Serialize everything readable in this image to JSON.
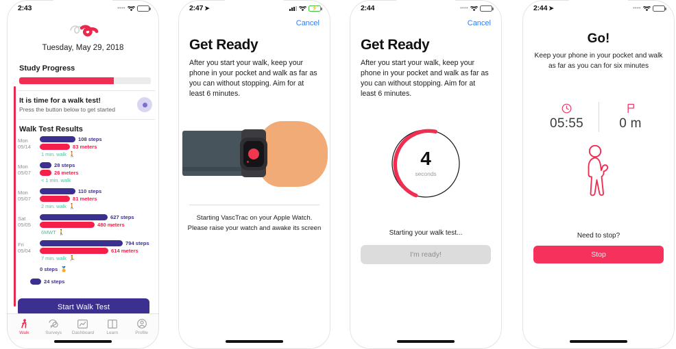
{
  "app": {
    "name": "VascTrac",
    "accent_red": "#ef2e51",
    "accent_purple": "#3b2f8f",
    "teal": "#45c3a0"
  },
  "screen1": {
    "status": {
      "time": "2:43",
      "signal": "signal-dots-icon",
      "wifi": "wifi-icon",
      "battery": "battery-icon"
    },
    "logo": "vasctrac-logo-icon",
    "date": "Tuesday, May 29, 2018",
    "study_progress": {
      "title": "Study Progress",
      "percent": 72
    },
    "walk_prompt": {
      "title": "It is time for a walk test!",
      "subtitle": "Press the button below to get started",
      "badge": "record-dot-icon"
    },
    "results": {
      "title": "Walk Test Results",
      "rows": [
        {
          "day": "Mon",
          "date": "05/14",
          "steps_label": "108 steps",
          "meters_label": "83 meters",
          "steps_width": 52,
          "meters_width": 44,
          "foot": "1 min. walk",
          "foot_icon": "walking-person-icon"
        },
        {
          "day": "Mon",
          "date": "05/07",
          "steps_label": "28 steps",
          "meters_label": "26 meters",
          "steps_width": 17,
          "meters_width": 17,
          "foot": "< 1 min. walk",
          "foot_icon": ""
        },
        {
          "day": "Mon",
          "date": "05/07",
          "steps_label": "110 steps",
          "meters_label": "81 meters",
          "steps_width": 52,
          "meters_width": 44,
          "foot": "2 min. walk",
          "foot_icon": "walking-person-icon"
        },
        {
          "day": "Sat",
          "date": "05/05",
          "steps_label": "627 steps",
          "meters_label": "480 meters",
          "steps_width": 99,
          "meters_width": 80,
          "foot": "6MWT",
          "foot_icon": "walking-person-icon"
        },
        {
          "day": "Fri",
          "date": "05/04",
          "steps_label": "794 steps",
          "meters_label": "614 meters",
          "steps_width": 121,
          "meters_width": 100,
          "foot": "7 min. walk",
          "foot_icon": "running-person-icon"
        },
        {
          "day": "",
          "date": "",
          "steps_label": "0 steps",
          "meters_label": "",
          "steps_width": 0,
          "meters_width": 0,
          "foot": "",
          "foot_icon": ""
        }
      ],
      "clipped_row_label": "24 steps"
    },
    "start_button": "Start Walk Test",
    "tabs": [
      {
        "label": "Walk",
        "icon": "walking-person-icon",
        "active": true
      },
      {
        "label": "Surveys",
        "icon": "survey-icon",
        "active": false
      },
      {
        "label": "Dashboard",
        "icon": "chart-icon",
        "active": false
      },
      {
        "label": "Learn",
        "icon": "book-icon",
        "active": false
      },
      {
        "label": "Profile",
        "icon": "profile-icon",
        "active": false
      }
    ]
  },
  "screen2": {
    "status": {
      "time": "2:47",
      "location_arrow": "location-arrow-icon",
      "signal": "signal-bars-icon",
      "wifi": "wifi-icon",
      "battery": "battery-charging-icon"
    },
    "cancel": "Cancel",
    "title": "Get Ready",
    "body": "After you start your walk, keep your phone in your pocket and walk as far as you can without stopping. Aim for at least 6 minutes.",
    "illustration": "apple-watch-on-wrist-illustration",
    "caption_line1": "Starting VascTrac on your Apple Watch.",
    "caption_line2": "Please raise your watch and awake its screen"
  },
  "screen3": {
    "status": {
      "time": "2:44",
      "signal": "signal-dots-icon",
      "wifi": "wifi-icon",
      "battery": "battery-icon"
    },
    "cancel": "Cancel",
    "title": "Get Ready",
    "body": "After you start your walk, keep your phone in your pocket and walk as far as you can without stopping. Aim for at least 6 minutes.",
    "countdown": {
      "value": "4",
      "unit": "seconds",
      "arc_percent": 60
    },
    "status_line": "Starting your walk test...",
    "ready_button": "I'm ready!"
  },
  "screen4": {
    "status": {
      "time": "2:44",
      "location_arrow": "location-arrow-icon",
      "signal": "signal-dots-icon",
      "wifi": "wifi-icon",
      "battery": "battery-icon"
    },
    "title": "Go!",
    "subtitle": "Keep your phone in your pocket and walk as far as you can for six minutes",
    "stats": [
      {
        "icon": "clock-icon",
        "value": "05:55"
      },
      {
        "icon": "flag-icon",
        "value": "0 m"
      }
    ],
    "figure": "walking-person-outline-icon",
    "need_stop": "Need to stop?",
    "stop_button": "Stop"
  }
}
